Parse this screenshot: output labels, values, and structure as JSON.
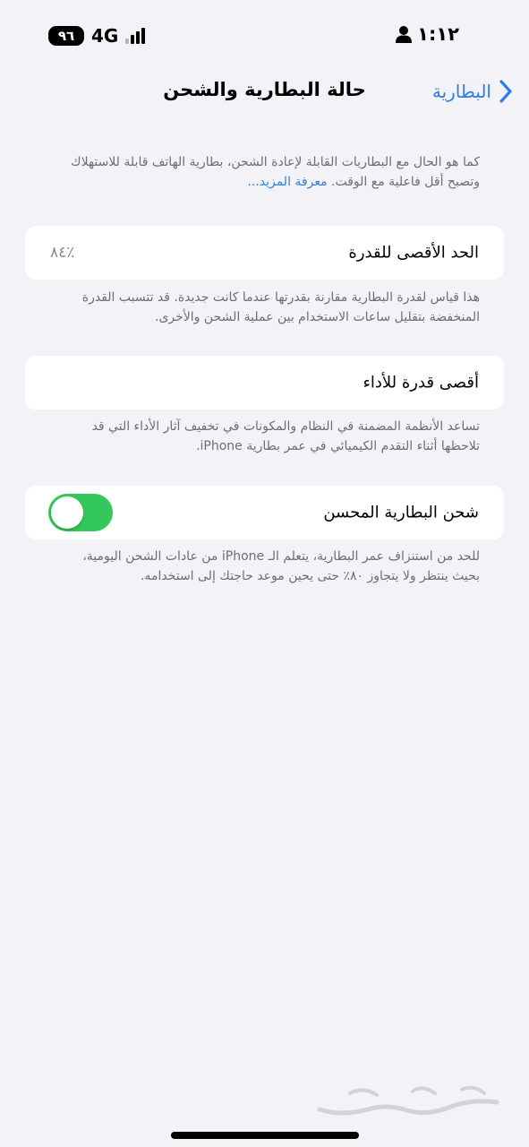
{
  "status_bar": {
    "battery": "٩٦",
    "network": "4G",
    "time": "١:١٢"
  },
  "nav": {
    "title": "حالة البطارية والشحن",
    "back_label": "البطارية",
    "accent_color": "#2f7fe0"
  },
  "intro": {
    "text": "كما هو الحال مع البطاريات القابلة لإعادة الشحن، بطارية الهاتف قابلة للاستهلاك وتصبح أقل فاعلية مع الوقت.",
    "link": "معرفة المزيد..."
  },
  "max_capacity": {
    "label": "الحد الأقصى للقدرة",
    "value": "٪٨٤",
    "description": "هذا قياس لقدرة البطارية مقارنة بقدرتها عندما كانت جديدة. قد تتسبب القدرة المنخفضة بتقليل ساعات الاستخدام بين عملية الشحن والأخرى."
  },
  "peak_performance": {
    "label": "أقصى قدرة للأداء",
    "description": "تساعد الأنظمة المضمنة في النظام والمكونات في تخفيف آثار الأداء التي قد تلاحظها أثناء التقدم الكيميائي في عمر بطارية iPhone."
  },
  "optimized_charging": {
    "label": "شحن البطارية المحسن",
    "enabled": true,
    "toggle_color": "#34c759",
    "description": "للحد من استنزاف عمر البطارية، يتعلم الـ iPhone من عادات الشحن اليومية، بحيث ينتظر ولا يتجاوز ٨٠٪ حتى يحين موعد حاجتك إلى استخدامه."
  }
}
